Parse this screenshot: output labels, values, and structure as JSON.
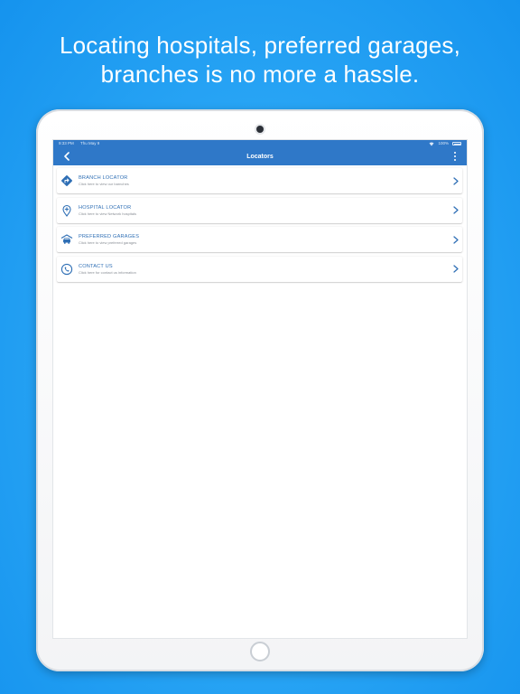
{
  "headline": {
    "line1": "Locating hospitals, preferred garages,",
    "line2": "branches is no more a hassle."
  },
  "status_bar": {
    "time": "9:33 PM",
    "date": "Thu May 9",
    "battery": "100%"
  },
  "nav": {
    "title": "Locators",
    "back_icon": "chevron-left-icon",
    "menu_icon": "more-vertical-icon"
  },
  "colors": {
    "primary": "#2f78c8",
    "link_text": "#2f6fb5",
    "subtext": "#8a8f96",
    "background_blue": "#2aa6f5"
  },
  "items": [
    {
      "title": "BRANCH LOCATOR",
      "subtitle": "Click here to view our barnches",
      "icon": "directions-sign-icon"
    },
    {
      "title": "HOSPITAL LOCATOR",
      "subtitle": "Click here to view Network hospitals",
      "icon": "hospital-pin-icon"
    },
    {
      "title": "PREFERRED GARAGES",
      "subtitle": "Click here to view preferred garages",
      "icon": "garage-icon"
    },
    {
      "title": "CONTACT US",
      "subtitle": "Click here for contact us information",
      "icon": "contact-phone-icon"
    }
  ]
}
